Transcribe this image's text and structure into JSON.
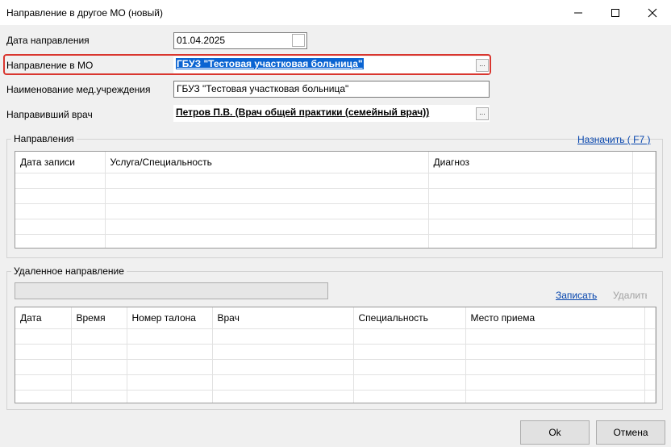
{
  "window": {
    "title": "Направление в другое МО (новый)"
  },
  "form": {
    "date_label": "Дата направления",
    "date_value": "01.04.2025",
    "mo_label": "Направление в МО",
    "mo_value": "ГБУЗ \"Тестовая участковая больница\"",
    "institution_label": "Наименование мед.учреждения",
    "institution_value": "ГБУЗ \"Тестовая участковая больница\"",
    "doctor_label": "Направивший врач",
    "doctor_value": "Петров П.В. (Врач общей практики (семейный врач))",
    "picker_glyph": "..."
  },
  "directions": {
    "title": "Направления",
    "assign_link": "Назначить ( F7 )",
    "columns": [
      "Дата записи",
      "Услуга/Специальность",
      "Диагноз",
      ""
    ]
  },
  "remote": {
    "title": "Удаленное направление",
    "record_link": "Записать",
    "delete_link": "Удалить",
    "columns": [
      "Дата",
      "Время",
      "Номер талона",
      "Врач",
      "Специальность",
      "Место приема",
      ""
    ]
  },
  "buttons": {
    "ok": "Ok",
    "cancel": "Отмена"
  },
  "icons": {
    "minimize": "minimize-icon",
    "maximize": "maximize-icon",
    "close": "close-icon"
  }
}
